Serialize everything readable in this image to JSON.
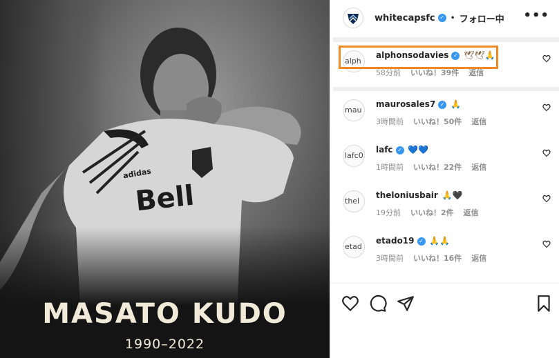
{
  "photo": {
    "name": "MASATO KUDO",
    "years": "1990–2022",
    "jersey_sponsor": "Bell",
    "kit_brand": "adidas"
  },
  "header": {
    "account": "whitecapsfc",
    "separator": "•",
    "follow_label": "フォロー中",
    "more_label": "•••"
  },
  "comments": [
    {
      "avatar": "alph",
      "user": "alphonsodavies",
      "emoji": "🕊🕊🙏",
      "time": "58分前",
      "likes": "いいね！39件",
      "reply": "返信"
    },
    {
      "avatar": "mau",
      "user": "maurosales7",
      "emoji": "🙏",
      "time": "3時間前",
      "likes": "いいね！50件",
      "reply": "返信"
    },
    {
      "avatar": "lafc0",
      "user": "lafc",
      "emoji": "💙💙",
      "time": "1時間前",
      "likes": "いいね！22件",
      "reply": "返信"
    },
    {
      "avatar": "thel",
      "user": "theloniusbair",
      "emoji": "🙏🖤",
      "time": "19分前",
      "likes": "いいね！2件",
      "reply": "返信"
    },
    {
      "avatar": "etad",
      "user": "etado19",
      "emoji": "🙏🙏",
      "time": "3時間前",
      "likes": "いいね！16件",
      "reply": "返信"
    }
  ],
  "colors": {
    "verified": "#3897f0",
    "highlight": "#f08a24",
    "name_text": "#f1ead8"
  },
  "icons": [
    "heart-icon",
    "comment-icon",
    "share-icon",
    "bookmark-icon",
    "verified-badge-icon",
    "whitecaps-logo"
  ]
}
